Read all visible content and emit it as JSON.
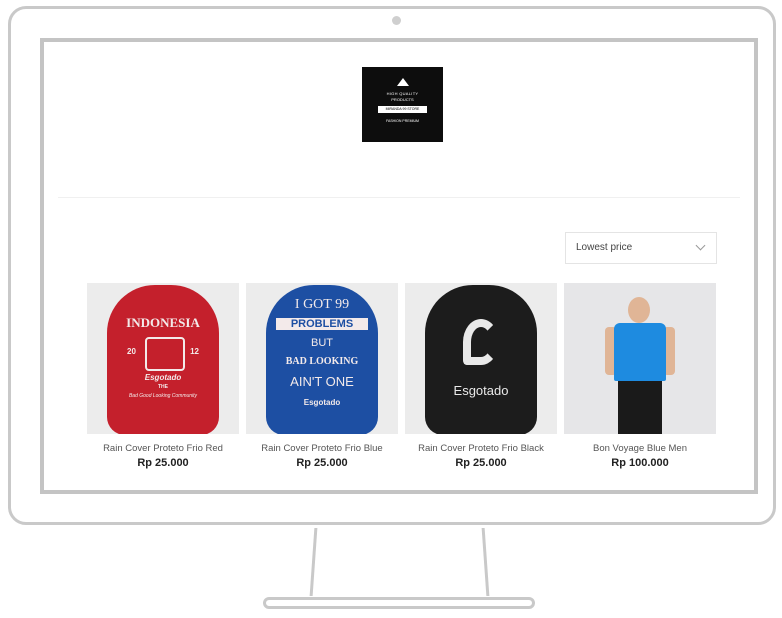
{
  "logo": {
    "line1": "HIGH QUALITY",
    "line2": "PRODUCTS",
    "ribbon": "MIRANDA 99 STORE",
    "line3": "FASHION PREMIUM"
  },
  "sort": {
    "selected": "Lowest price",
    "icon": "chevron-down-icon"
  },
  "products": [
    {
      "name": "Rain Cover Proteto Frio Red",
      "price": "Rp 25.000",
      "print": [
        "INDONESIA",
        "20",
        "12",
        "Esgotado",
        "THE",
        "Bad Good Looking Community"
      ]
    },
    {
      "name": "Rain Cover Proteto Frio Blue",
      "price": "Rp 25.000",
      "print": [
        "I GOT 99",
        "PROBLEMS",
        "BUT",
        "BAD LOOKING",
        "AIN'T ONE",
        "Esgotado"
      ]
    },
    {
      "name": "Rain Cover Proteto Frio Black",
      "price": "Rp 25.000",
      "print": [
        "Esgotado"
      ]
    },
    {
      "name": "Bon Voyage Blue Men",
      "price": "Rp 100.000"
    }
  ],
  "colors": {
    "red_bag": "#c4202c",
    "blue_bag": "#1d4fa3",
    "black_bag": "#1c1c1c",
    "tshirt": "#1e8be0",
    "frame": "#c9c9c9"
  }
}
